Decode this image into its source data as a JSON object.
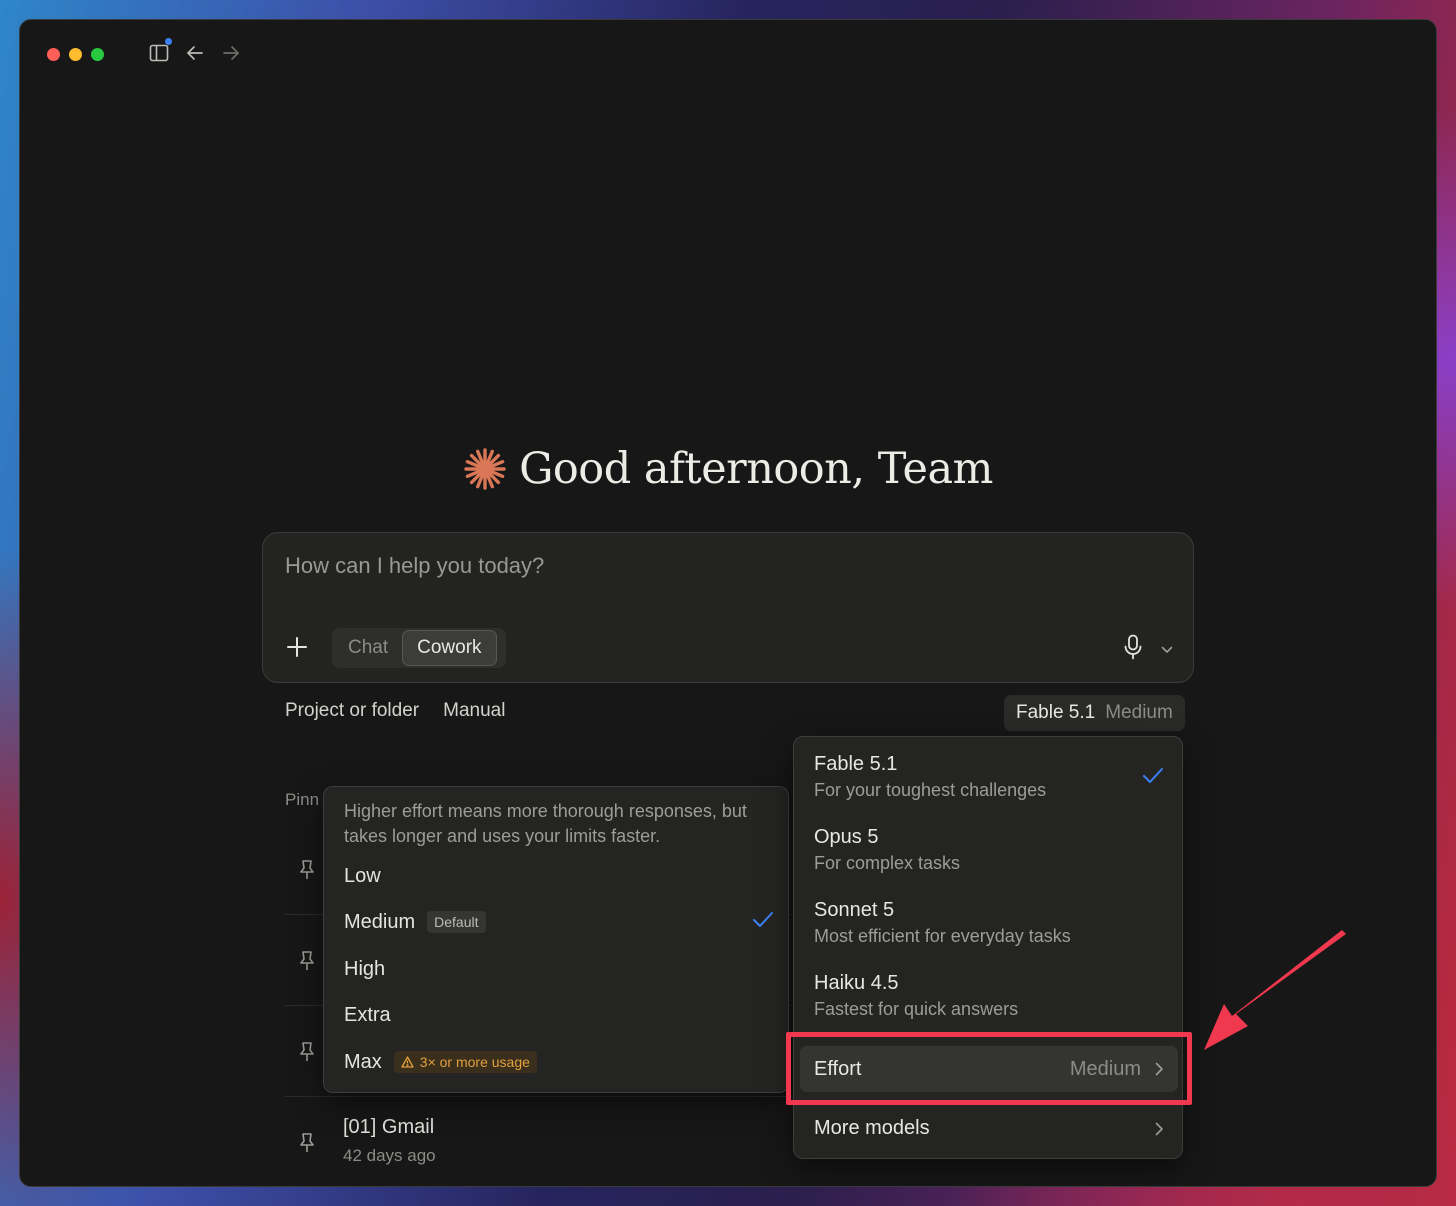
{
  "greeting": {
    "text": "Good afternoon, Team"
  },
  "composer": {
    "placeholder": "How can I help you today?",
    "modes": [
      "Chat",
      "Cowork"
    ],
    "active_mode": "Cowork"
  },
  "toolbar_row": {
    "project": "Project or folder",
    "manual": "Manual"
  },
  "model_chip": {
    "model": "Fable 5.1",
    "effort": "Medium"
  },
  "pinned": {
    "label": "Pinn",
    "items": [
      {
        "title": "[01] Gmail",
        "sub": "42 days ago"
      }
    ]
  },
  "effort_menu": {
    "description": "Higher effort means more thorough responses, but takes longer and uses your limits faster.",
    "options": [
      {
        "label": "Low"
      },
      {
        "label": "Medium",
        "badge": "Default",
        "selected": true
      },
      {
        "label": "High"
      },
      {
        "label": "Extra"
      },
      {
        "label": "Max",
        "warning": "3× or more usage"
      }
    ]
  },
  "model_menu": {
    "models": [
      {
        "name": "Fable 5.1",
        "desc": "For your toughest challenges",
        "selected": true
      },
      {
        "name": "Opus 5",
        "desc": "For complex tasks"
      },
      {
        "name": "Sonnet 5",
        "desc": "Most efficient for everyday tasks"
      },
      {
        "name": "Haiku 4.5",
        "desc": "Fastest for quick answers"
      }
    ],
    "effort_label": "Effort",
    "effort_value": "Medium",
    "more_models": "More models"
  },
  "colors": {
    "accent": "#d97757",
    "check": "#3b82f6",
    "highlight": "#f0384e",
    "warning": "#e3a03d"
  },
  "icons": [
    "sidebar-icon",
    "back-arrow-icon",
    "forward-arrow-icon",
    "spark-logo-icon",
    "plus-icon",
    "microphone-icon",
    "chevron-down-icon",
    "pin-icon",
    "check-icon",
    "chevron-right-icon",
    "warning-icon",
    "annotation-arrow-icon"
  ]
}
